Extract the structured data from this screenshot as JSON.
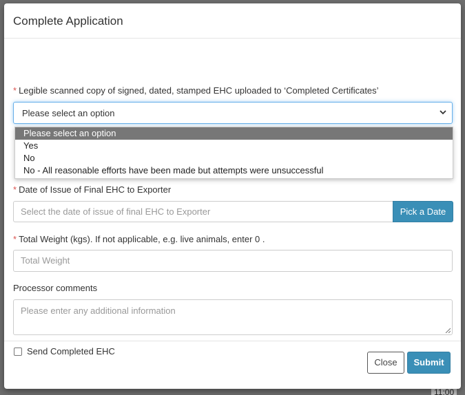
{
  "modal": {
    "title": "Complete Application"
  },
  "form": {
    "ehc_upload": {
      "required_mark": "*",
      "label": "Legible scanned copy of signed, dated, stamped EHC uploaded to ‘Completed Certificates’",
      "selected_value": "Please select an option",
      "options": [
        "Please select an option",
        "Yes",
        "No",
        "No - All reasonable efforts have been made but attempts were unsuccessful"
      ]
    },
    "date_of_issue": {
      "required_mark": "*",
      "label": "Date of Issue of Final EHC to Exporter",
      "placeholder": "Select the date of issue of final EHC to Exporter",
      "button_label": "Pick a Date"
    },
    "total_weight": {
      "required_mark": "*",
      "label": "Total Weight (kgs). If not applicable, e.g. live animals, enter 0 .",
      "placeholder": "Total Weight"
    },
    "processor_comments": {
      "label": "Processor comments",
      "placeholder": "Please enter any additional information"
    },
    "send_completed_ehc": {
      "label": "Send Completed EHC",
      "checked": false
    }
  },
  "footer": {
    "close_label": "Close",
    "submit_label": "Submit"
  },
  "background": {
    "time_label": "11:00"
  },
  "colors": {
    "accent": "#3a8fb7",
    "required": "#d9534f",
    "selected_option_bg": "#777777"
  }
}
